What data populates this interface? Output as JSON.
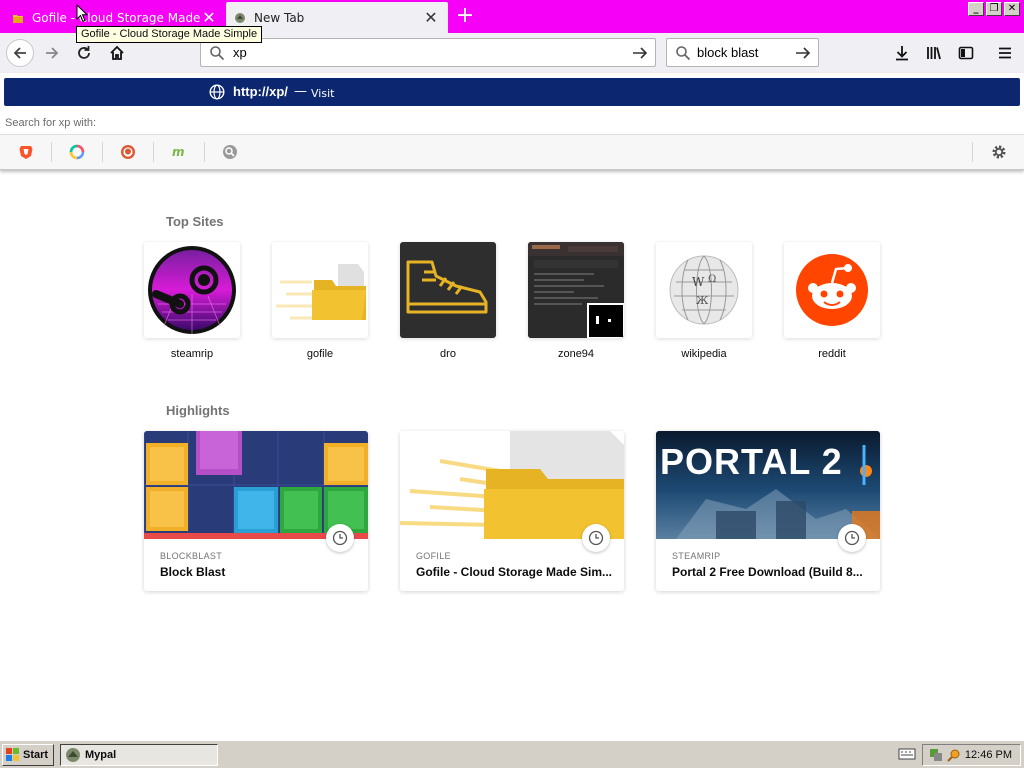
{
  "browser": {
    "tabs": [
      {
        "title": "Gofile - Cloud Storage Made Simple",
        "active": true
      },
      {
        "title": "New Tab",
        "active": false
      }
    ],
    "tooltip": "Gofile - Cloud Storage Made Simple",
    "address_value": "xp",
    "search_value": "block blast"
  },
  "dropdown": {
    "visit_url": "http://xp/",
    "visit_separator": "—",
    "visit_action": "Visit",
    "search_for": "Search for xp with:",
    "engines": [
      "brave-icon",
      "qwant-icon",
      "duckduckgo-icon",
      "mojeek-icon",
      "searx-icon"
    ]
  },
  "top_sites": {
    "title": "Top Sites",
    "items": [
      {
        "label": "steamrip",
        "icon": "steam-logo"
      },
      {
        "label": "gofile",
        "icon": "folder-icon"
      },
      {
        "label": "dro",
        "icon": "shoe-icon"
      },
      {
        "label": "zone94",
        "icon": "site-screenshot"
      },
      {
        "label": "wikipedia",
        "icon": "wikipedia-globe"
      },
      {
        "label": "reddit",
        "icon": "reddit-alien"
      }
    ]
  },
  "highlights": {
    "title": "Highlights",
    "items": [
      {
        "source": "BLOCKBLAST",
        "title": "Block Blast"
      },
      {
        "source": "GOFILE",
        "title": "Gofile - Cloud Storage Made Sim..."
      },
      {
        "source": "STEAMRIP",
        "title": "Portal 2 Free Download (Build 8...",
        "image_text": "PORTAL 2"
      }
    ]
  },
  "taskbar": {
    "start_label": "Start",
    "task_label": "Mypal",
    "clock": "12:46 PM"
  },
  "colors": {
    "tabstrip": "#f700f7",
    "visit_row": "#0c2770",
    "gofile_yellow": "#e6b325",
    "reddit_orange": "#ff4500"
  }
}
